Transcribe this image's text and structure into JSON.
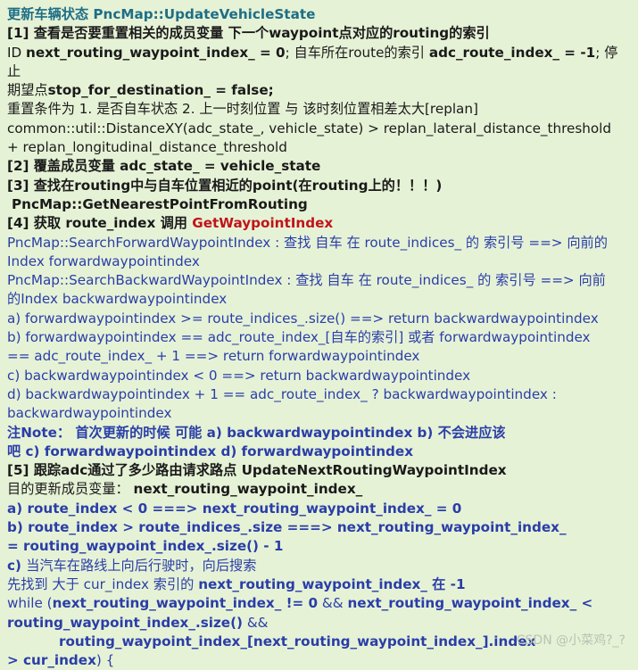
{
  "title": "更新车辆状态 PncMap::UpdateVehicleState",
  "s1": {
    "l1": "[1] 查看是否要重置相关的成员变量 下一个waypoint点对应的routing的索引",
    "l2a": "ID ",
    "l2b": "next_routing_waypoint_index_ = 0",
    "l2c": "; 自车所在route的索引 ",
    "l2d": "adc_route_index_ = -1",
    "l2e": "; 停止",
    "l3a": "期望点",
    "l3b": "stop_for_destination_ = false;",
    "l4": "重置条件为 1. 是否自车状态 2. 上一时刻位置 与 该时刻位置相差太大[replan]",
    "l5": "common::util::DistanceXY(adc_state_, vehicle_state) > replan_lateral_distance_threshold",
    "l6": "+ replan_longitudinal_distance_threshold"
  },
  "s2": "[2] 覆盖成员变量 adc_state_  = vehicle_state",
  "s3": {
    "l1": "[3] 查找在routing中与自车位置相近的point(在routing上的！！！)",
    "l2": "PncMap::GetNearestPointFromRouting"
  },
  "s4": {
    "l1a": "[4] 获取 route_index 调用 ",
    "l1b": "GetWaypointIndex",
    "l2": "PncMap::SearchForwardWaypointIndex : 查找 自车 在 route_indices_ 的 索引号 ==> 向前的",
    "l3": "Index forwardwaypointindex",
    "l4": "PncMap::SearchBackwardWaypointIndex : 查找 自车 在 route_indices_ 的 索引号 ==> 向前",
    "l5": "的Index backwardwaypointindex",
    "l6": "a) forwardwaypointindex >= route_indices_.size() ==> return backwardwaypointindex",
    "l7": "b) forwardwaypointindex == adc_route_index_[自车的索引] 或者 forwardwaypointindex",
    "l8": "== adc_route_index_ + 1 ==> return forwardwaypointindex",
    "l9": "c) backwardwaypointindex < 0 ==> return backwardwaypointindex",
    "l10": "d) backwardwaypointindex + 1 ==  adc_route_index_ ?  backwardwaypointindex :",
    "l11": "backwardwaypointindex",
    "l12": "注Note： 首次更新的时候 可能 a) backwardwaypointindex b) 不会进应该",
    "l13": "吧  c) forwardwaypointindex  d) forwardwaypointindex"
  },
  "s5": {
    "l1a": "[5]  跟踪adc通过了多少路由请求路点 ",
    "l1b": "UpdateNextRoutingWaypointIndex",
    "l2a": "目的更新成员变量： ",
    "l2b": "next_routing_waypoint_index_",
    "l3": "a) route_index < 0 ===>  next_routing_waypoint_index_ = 0",
    "l4": "b) route_index > route_indices_.size ===> next_routing_waypoint_index_",
    "l5": "= routing_waypoint_index_.size() - 1",
    "l6a": "c) ",
    "l6b": "当汽车在路线上向后行驶时，向后搜索",
    "l7a": "先找到 大于 cur_index 索引的 ",
    "l7b": "next_routing_waypoint_index_ 在 -1",
    "l8a": " while (",
    "l8b": "next_routing_waypoint_index_ != 0",
    "l8c": " && ",
    "l8d": "next_routing_waypoint_index_ <",
    "l9a": "routing_waypoint_index_.size()",
    "l9b": " &&",
    "l10": "routing_waypoint_index_[next_routing_waypoint_index_].index",
    "l11a": "> cur_index",
    "l11b": ") {"
  },
  "watermark": "CSDN @小菜鸡?_?"
}
